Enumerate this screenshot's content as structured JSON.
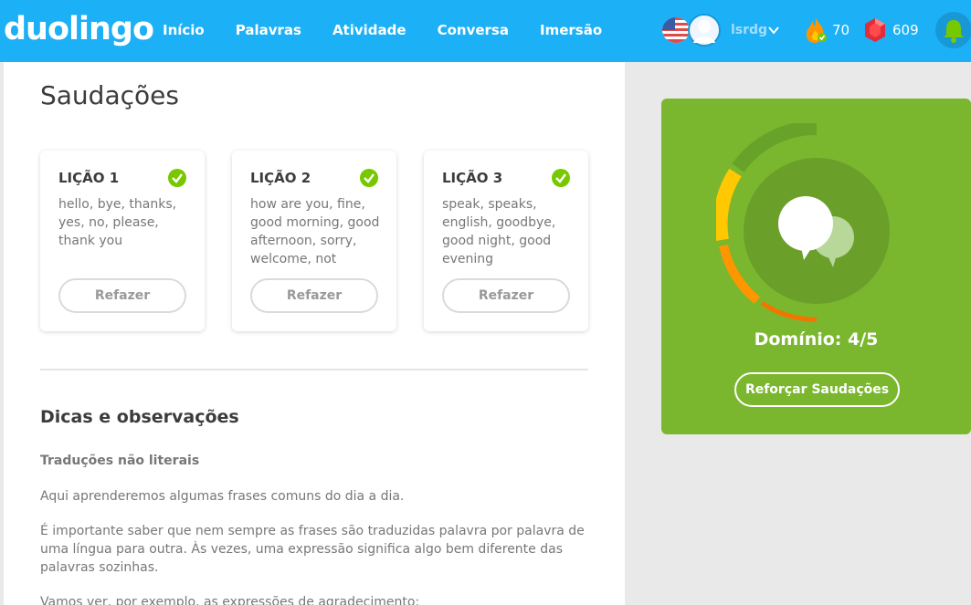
{
  "header": {
    "logo": "duolingo",
    "nav": [
      "Início",
      "Palavras",
      "Atividade",
      "Conversa",
      "Imersão"
    ],
    "username": "lsrdg",
    "streak": "70",
    "gems": "609"
  },
  "skill": {
    "title": "Saudações",
    "lessons": [
      {
        "title": "LIÇÃO 1",
        "words": "hello, bye, thanks, yes, no, please, thank you",
        "button": "Refazer"
      },
      {
        "title": "LIÇÃO 2",
        "words": "how are you, fine, good morning, good afternoon, sorry, welcome, not",
        "button": "Refazer"
      },
      {
        "title": "LIÇÃO 3",
        "words": "speak, speaks, english, goodbye, good night, good evening",
        "button": "Refazer"
      }
    ]
  },
  "tips": {
    "title": "Dicas e observações",
    "subtitle": "Traduções não literais",
    "paragraphs": [
      "Aqui aprenderemos algumas frases comuns do dia a dia.",
      "É importante saber que nem sempre as frases são traduzidas palavra por palavra de uma língua para outra. Às vezes, uma expressão significa algo bem diferente das palavras sozinhas.",
      "Vamos ver, por exemplo, as expressões de agradecimento:"
    ]
  },
  "mastery": {
    "label": "Domínio: 4/5",
    "level": 4,
    "max": 5,
    "button": "Reforçar Saudações"
  },
  "colors": {
    "header": "#1cb0f6",
    "mastery_bg": "#7ab72e",
    "check": "#78c800"
  },
  "icons": [
    "us-flag-icon",
    "avatar-icon",
    "chevron-down-icon",
    "flame-icon",
    "gem-icon",
    "bell-icon",
    "checkmark-icon",
    "speech-bubbles-icon"
  ]
}
